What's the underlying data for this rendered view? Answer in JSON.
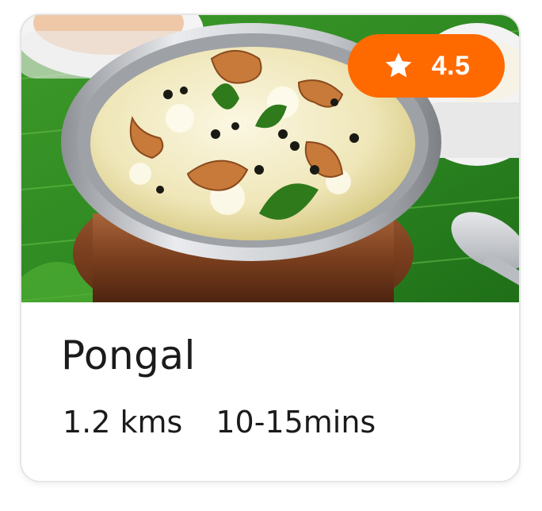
{
  "card": {
    "image_alt": "Pongal in a steel and copper bowl on banana leaf",
    "rating": "4.5",
    "rating_icon": "star-icon",
    "dish_name": "Pongal",
    "distance": "1.2 kms",
    "delivery_time": "10-15mins"
  },
  "colors": {
    "rating_badge": "#ff6a00",
    "text": "#1b1b1b",
    "card_border": "#e6e6e6"
  }
}
